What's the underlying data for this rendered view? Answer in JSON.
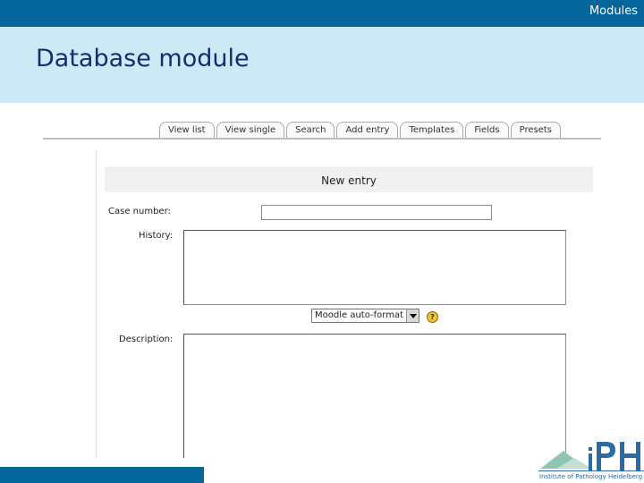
{
  "header": {
    "section_label": "Modules",
    "title": "Database module",
    "colors": {
      "top_bar": "#04669a",
      "title_band": "#cde9f6",
      "title_text": "#0f2f6f"
    }
  },
  "tabs": [
    {
      "label": "View list"
    },
    {
      "label": "View single"
    },
    {
      "label": "Search"
    },
    {
      "label": "Add entry"
    },
    {
      "label": "Templates"
    },
    {
      "label": "Fields"
    },
    {
      "label": "Presets"
    }
  ],
  "form": {
    "title": "New entry",
    "case_number": {
      "label": "Case number:",
      "value": ""
    },
    "history": {
      "label": "History:",
      "value": ""
    },
    "format_select": {
      "value": "Moodle auto-format"
    },
    "help_icon": "help-icon",
    "description": {
      "label": "Description:",
      "value": ""
    }
  },
  "footer": {
    "logo_name": "iPH",
    "logo_caption": "Institute of Pathology Heidelberg"
  }
}
